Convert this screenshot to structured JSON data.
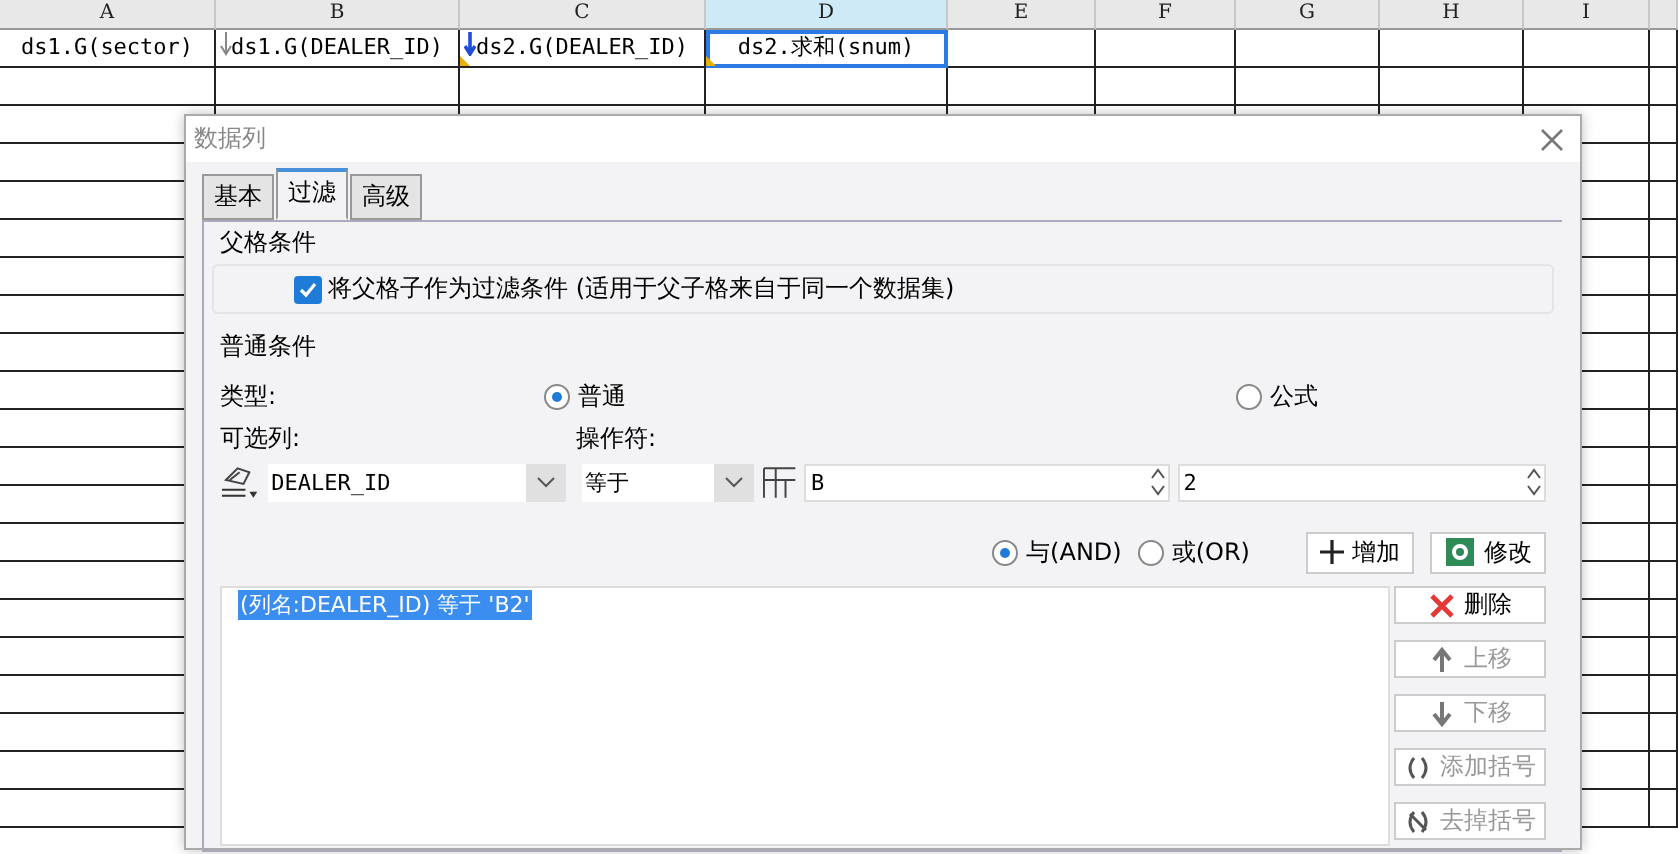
{
  "sheet": {
    "columns": [
      {
        "label": "A",
        "selected": false
      },
      {
        "label": "B",
        "selected": false
      },
      {
        "label": "C",
        "selected": false
      },
      {
        "label": "D",
        "selected": true
      },
      {
        "label": "E",
        "selected": false
      },
      {
        "label": "F",
        "selected": false
      },
      {
        "label": "G",
        "selected": false
      },
      {
        "label": "H",
        "selected": false
      },
      {
        "label": "I",
        "selected": false
      }
    ],
    "cells": [
      {
        "text": "ds1.G(sector)",
        "selected": false,
        "expand_down": false,
        "corner_mark": false
      },
      {
        "text": "ds1.G(DEALER_ID)",
        "selected": false,
        "expand_down": true,
        "linked": false,
        "corner_mark": false
      },
      {
        "text": "ds2.G(DEALER_ID)",
        "selected": false,
        "expand_down": true,
        "linked": true,
        "corner_mark": true
      },
      {
        "text": "ds2.求和(snum)",
        "selected": true,
        "expand_down": false,
        "corner_mark": true
      }
    ]
  },
  "dialog": {
    "title": "数据列",
    "tabs": [
      {
        "label": "基本",
        "selected": false
      },
      {
        "label": "过滤",
        "selected": true
      },
      {
        "label": "高级",
        "selected": false
      }
    ],
    "parent_group": {
      "title": "父格条件",
      "checkbox": {
        "label": "将父格子作为过滤条件 (适用于父子格来自于同一个数据集)",
        "checked": true
      }
    },
    "normal_group": {
      "title": "普通条件",
      "type_label": "类型:",
      "type_options": [
        {
          "label": "普通",
          "selected": true
        },
        {
          "label": "公式",
          "selected": false
        }
      ],
      "column_label": "可选列:",
      "column_value": "DEALER_ID",
      "operator_label": "操作符:",
      "operator_value": "等于",
      "value_field": "B",
      "spin_field": "2",
      "join_options": [
        {
          "label": "与(AND)",
          "selected": true
        },
        {
          "label": "或(OR)",
          "selected": false
        }
      ],
      "add_button": "增加",
      "modify_button": "修改",
      "conditions": [
        {
          "text": "(列名:DEALER_ID) 等于 'B2'",
          "selected": true
        }
      ],
      "side_buttons": [
        {
          "kind": "delete",
          "label": "删除",
          "disabled": false
        },
        {
          "kind": "up",
          "label": "上移",
          "disabled": true
        },
        {
          "kind": "down",
          "label": "下移",
          "disabled": true
        },
        {
          "kind": "add-paren",
          "label": "添加括号",
          "disabled": true
        },
        {
          "kind": "remove-paren",
          "label": "去掉括号",
          "disabled": true
        }
      ]
    }
  }
}
